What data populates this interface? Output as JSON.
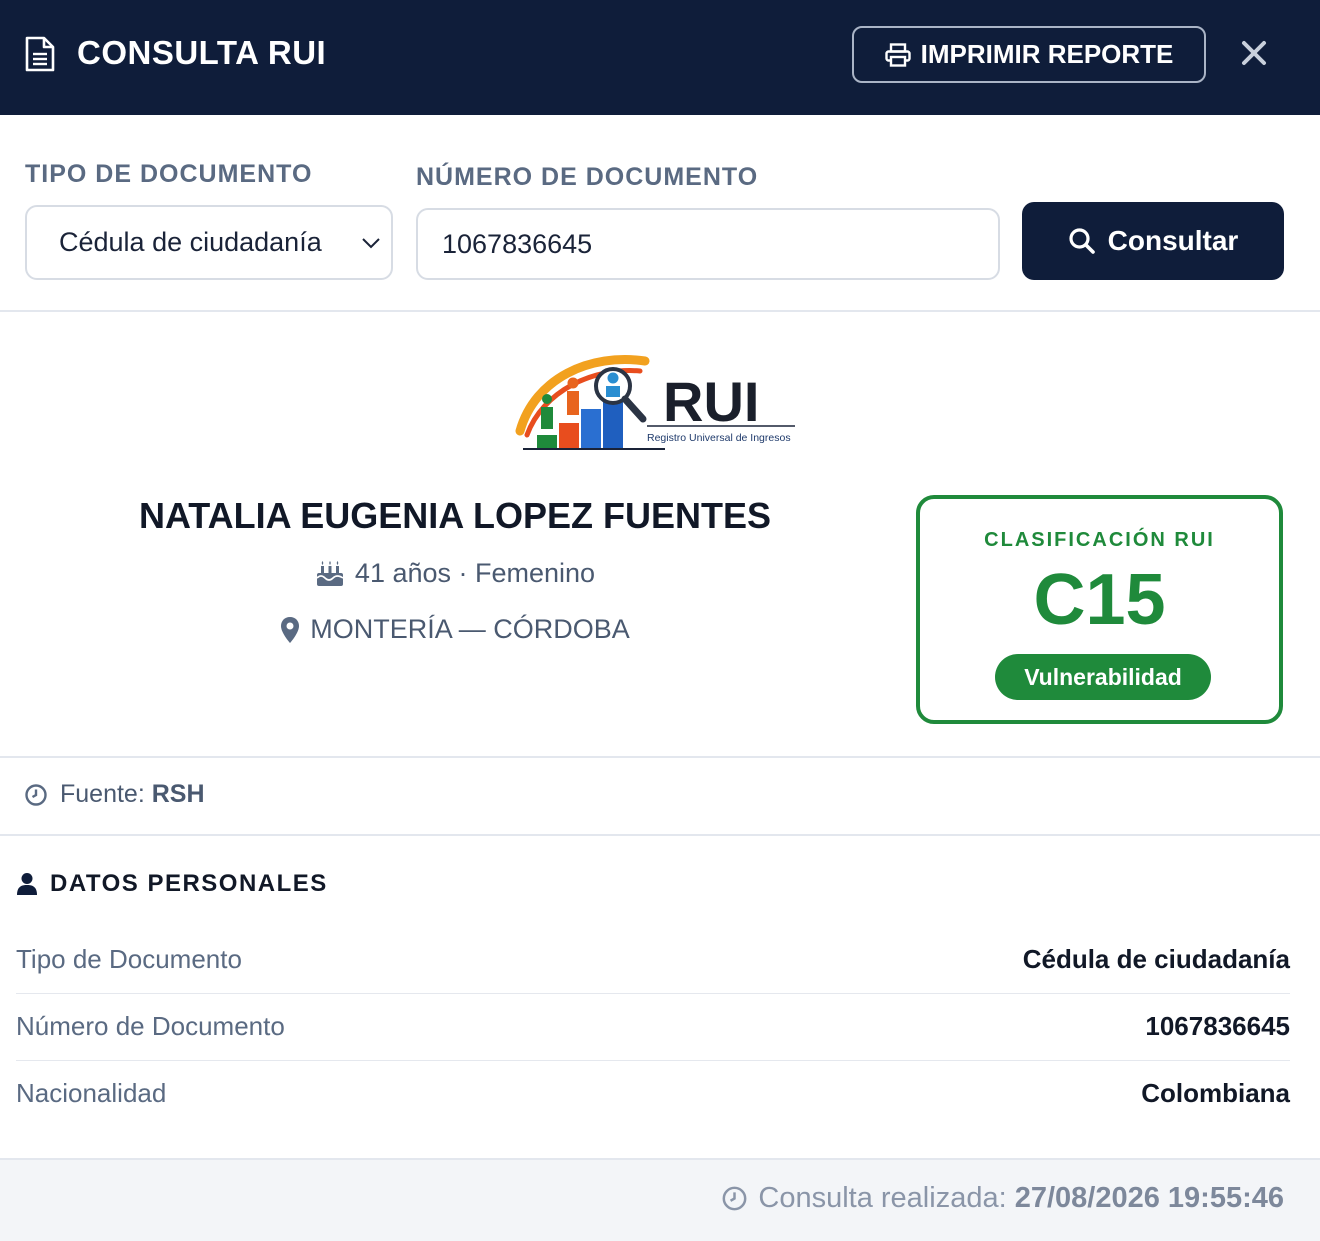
{
  "header": {
    "title": "CONSULTA RUI",
    "print_label": "IMPRIMIR REPORTE"
  },
  "search": {
    "doc_type_label": "TIPO DE DOCUMENTO",
    "doc_type_value": "Cédula de ciudadanía",
    "doc_number_label": "NÚMERO DE DOCUMENTO",
    "doc_number_value": "1067836645",
    "consult_label": "Consultar"
  },
  "logo": {
    "text": "RUI",
    "subtitle": "Registro Universal de Ingresos"
  },
  "person": {
    "name": "NATALIA EUGENIA LOPEZ FUENTES",
    "age_gender": "41 años · Femenino",
    "location": "MONTERÍA — CÓRDOBA"
  },
  "classification": {
    "label": "CLASIFICACIÓN RUI",
    "code": "C15",
    "badge": "Vulnerabilidad",
    "color": "#1f8a3b"
  },
  "source": {
    "label": "Fuente:",
    "value": "RSH"
  },
  "personal": {
    "title": "DATOS PERSONALES",
    "rows": [
      {
        "key": "Tipo de Documento",
        "value": "Cédula de ciudadanía"
      },
      {
        "key": "Número de Documento",
        "value": "1067836645"
      },
      {
        "key": "Nacionalidad",
        "value": "Colombiana"
      }
    ]
  },
  "footer": {
    "label": "Consulta realizada:",
    "timestamp": "27/08/2026 19:55:46"
  },
  "icons": {
    "document": "document-icon",
    "printer": "printer-icon",
    "close": "close-icon",
    "search": "search-icon",
    "cake": "birthday-cake-icon",
    "pin": "map-pin-icon",
    "clock": "clock-icon",
    "user": "user-icon"
  },
  "colors": {
    "header_bg": "#0f1d3a",
    "accent_green": "#1f8a3b"
  }
}
